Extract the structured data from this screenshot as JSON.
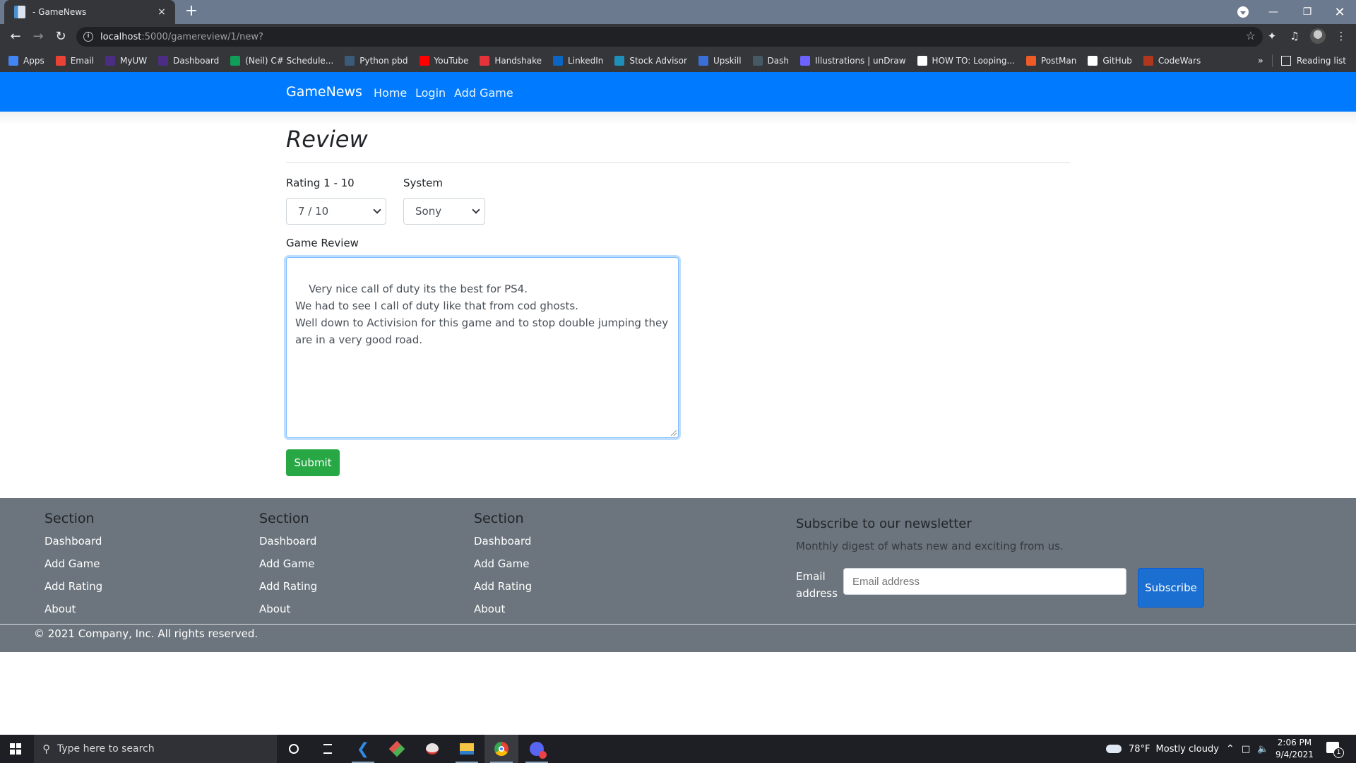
{
  "browser": {
    "tab_title": "- GameNews",
    "tab_close": "×",
    "new_tab": "+",
    "url_host": "localhost",
    "url_rest": ":5000/gamereview/1/new?",
    "bookmarks": [
      {
        "label": "Apps",
        "icon": "apps-grid-icon",
        "color": "#4285f4"
      },
      {
        "label": "Email",
        "icon": "gmail-icon",
        "color": "#ea4335"
      },
      {
        "label": "MyUW",
        "icon": "uw-icon",
        "color": "#4b2e83"
      },
      {
        "label": "Dashboard",
        "icon": "uw-dashboard-icon",
        "color": "#4b2e83"
      },
      {
        "label": "(Neil) C# Schedule...",
        "icon": "sheets-icon",
        "color": "#0f9d58"
      },
      {
        "label": "Python pbd",
        "icon": "python-icon",
        "color": "#3b5b7a"
      },
      {
        "label": "YouTube",
        "icon": "youtube-icon",
        "color": "#ff0000"
      },
      {
        "label": "Handshake",
        "icon": "handshake-icon",
        "color": "#e5333a"
      },
      {
        "label": "LinkedIn",
        "icon": "linkedin-icon",
        "color": "#0a66c2"
      },
      {
        "label": "Stock Advisor",
        "icon": "stock-advisor-icon",
        "color": "#1d8fb8"
      },
      {
        "label": "Upskill",
        "icon": "upskill-icon",
        "color": "#3b6fd8"
      },
      {
        "label": "Dash",
        "icon": "dash-icon",
        "color": "#455a64"
      },
      {
        "label": "Illustrations | unDraw",
        "icon": "undraw-icon",
        "color": "#6c63ff"
      },
      {
        "label": "HOW TO: Looping...",
        "icon": "paypal-doc-icon",
        "color": "#ffffff"
      },
      {
        "label": "PostMan",
        "icon": "postman-icon",
        "color": "#ef5b25"
      },
      {
        "label": "GitHub",
        "icon": "github-icon",
        "color": "#ffffff"
      },
      {
        "label": "CodeWars",
        "icon": "codewars-icon",
        "color": "#b1361e"
      }
    ],
    "more_bookmarks": "»",
    "reading_list": "Reading list"
  },
  "navbar": {
    "brand": "GameNews",
    "links": [
      "Home",
      "Login",
      "Add Game"
    ],
    "color": "#007bff"
  },
  "form": {
    "title": "Review",
    "rating_label": "Rating 1 - 10",
    "rating_value": "7 / 10",
    "system_label": "System",
    "system_value": "Sony",
    "review_label": "Game Review",
    "review_text": "Very nice call of duty its the best for PS4.\nWe had to see I call of duty like that from cod ghosts.\nWell down to Activision for this game and to stop double jumping they are in a very good road.",
    "submit_label": "Submit",
    "submit_color": "#28a745"
  },
  "footer": {
    "columns": [
      {
        "heading": "Section",
        "links": [
          "Dashboard",
          "Add Game",
          "Add Rating",
          "About"
        ]
      },
      {
        "heading": "Section",
        "links": [
          "Dashboard",
          "Add Game",
          "Add Rating",
          "About"
        ]
      },
      {
        "heading": "Section",
        "links": [
          "Dashboard",
          "Add Game",
          "Add Rating",
          "About"
        ]
      }
    ],
    "newsletter": {
      "title": "Subscribe to our newsletter",
      "description": "Monthly digest of whats new and exciting from us.",
      "email_label": "Email address",
      "email_placeholder": "Email address",
      "subscribe_label": "Subscribe"
    },
    "copyright": "© 2021 Company, Inc. All rights reserved.",
    "background": "#6c757d"
  },
  "taskbar": {
    "search_placeholder": "Type here to search",
    "apps": [
      "cortana",
      "task-view",
      "vscode",
      "git-kraken",
      "snip-sketch",
      "file-explorer",
      "chrome",
      "discord"
    ],
    "weather_temp": "78°F",
    "weather_desc": "Mostly cloudy",
    "time": "2:06 PM",
    "date": "9/4/2021",
    "notification_count": "1"
  }
}
